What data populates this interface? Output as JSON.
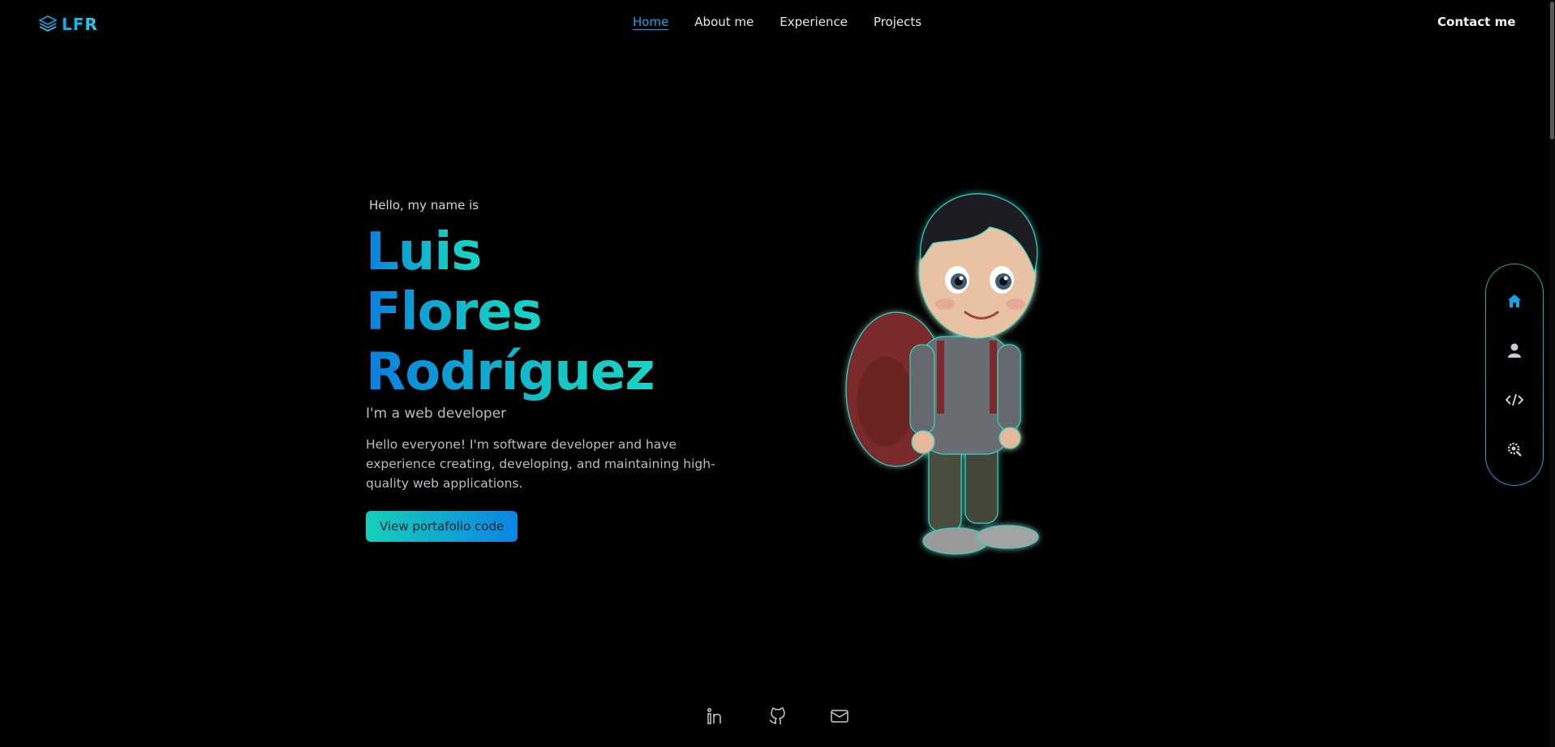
{
  "header": {
    "logo_text": "LFR",
    "nav": [
      {
        "label": "Home",
        "active": true
      },
      {
        "label": "About me",
        "active": false
      },
      {
        "label": "Experience",
        "active": false
      },
      {
        "label": "Projects",
        "active": false
      }
    ],
    "contact_label": "Contact me"
  },
  "hero": {
    "greeting": "Hello, my name is",
    "name_lines": [
      "Luis",
      "Flores",
      "Rodríguez"
    ],
    "role": "I'm a web developer",
    "intro": "Hello everyone! I'm software developer and have experience creating, developing, and maintaining high-quality web applications.",
    "cta_label": "View portafolio code"
  },
  "dock": {
    "items": [
      {
        "icon": "home-icon",
        "active": true
      },
      {
        "icon": "user-icon",
        "active": false
      },
      {
        "icon": "code-icon",
        "active": false
      },
      {
        "icon": "settings-search-icon",
        "active": false
      }
    ]
  },
  "socials": [
    {
      "icon": "linkedin-icon"
    },
    {
      "icon": "github-icon"
    },
    {
      "icon": "mail-icon"
    }
  ],
  "colors": {
    "accent_blue": "#0ea5e9",
    "accent_teal": "#14d0b8",
    "background": "#000000"
  }
}
